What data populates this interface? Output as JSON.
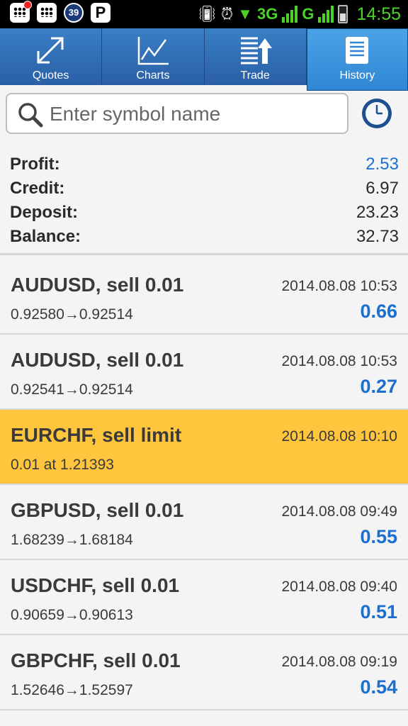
{
  "status_bar": {
    "badge_count": "39",
    "p_icon": "P",
    "network_3g": "3G",
    "network_g": "G",
    "time": "14:55"
  },
  "tabs": [
    {
      "label": "Quotes",
      "icon": "quotes-arrows-icon"
    },
    {
      "label": "Charts",
      "icon": "chart-line-icon"
    },
    {
      "label": "Trade",
      "icon": "trade-list-icon"
    },
    {
      "label": "History",
      "icon": "history-book-icon",
      "active": true
    }
  ],
  "search": {
    "placeholder": "Enter symbol name",
    "value": ""
  },
  "summary": {
    "profit": {
      "label": "Profit:",
      "value": "2.53"
    },
    "credit": {
      "label": "Credit:",
      "value": "6.97"
    },
    "deposit": {
      "label": "Deposit:",
      "value": "23.23"
    },
    "balance": {
      "label": "Balance:",
      "value": "32.73"
    }
  },
  "colors": {
    "accent_blue": "#1a6fd0",
    "highlight": "#ffc53d",
    "tab_blue": "#2f86d4"
  },
  "history": [
    {
      "title": "AUDUSD, sell 0.01",
      "date": "2014.08.08 10:53",
      "prices": "0.92580→0.92514",
      "profit": "0.66"
    },
    {
      "title": "AUDUSD, sell 0.01",
      "date": "2014.08.08 10:53",
      "prices": "0.92541→0.92514",
      "profit": "0.27"
    },
    {
      "title": "EURCHF, sell limit",
      "date": "2014.08.08 10:10",
      "prices": "0.01 at 1.21393",
      "profit": ""
    },
    {
      "title": "GBPUSD, sell 0.01",
      "date": "2014.08.08 09:49",
      "prices": "1.68239→1.68184",
      "profit": "0.55"
    },
    {
      "title": "USDCHF, sell 0.01",
      "date": "2014.08.08 09:40",
      "prices": "0.90659→0.90613",
      "profit": "0.51"
    },
    {
      "title": "GBPCHF, sell 0.01",
      "date": "2014.08.08 09:19",
      "prices": "1.52646→1.52597",
      "profit": "0.54"
    }
  ]
}
